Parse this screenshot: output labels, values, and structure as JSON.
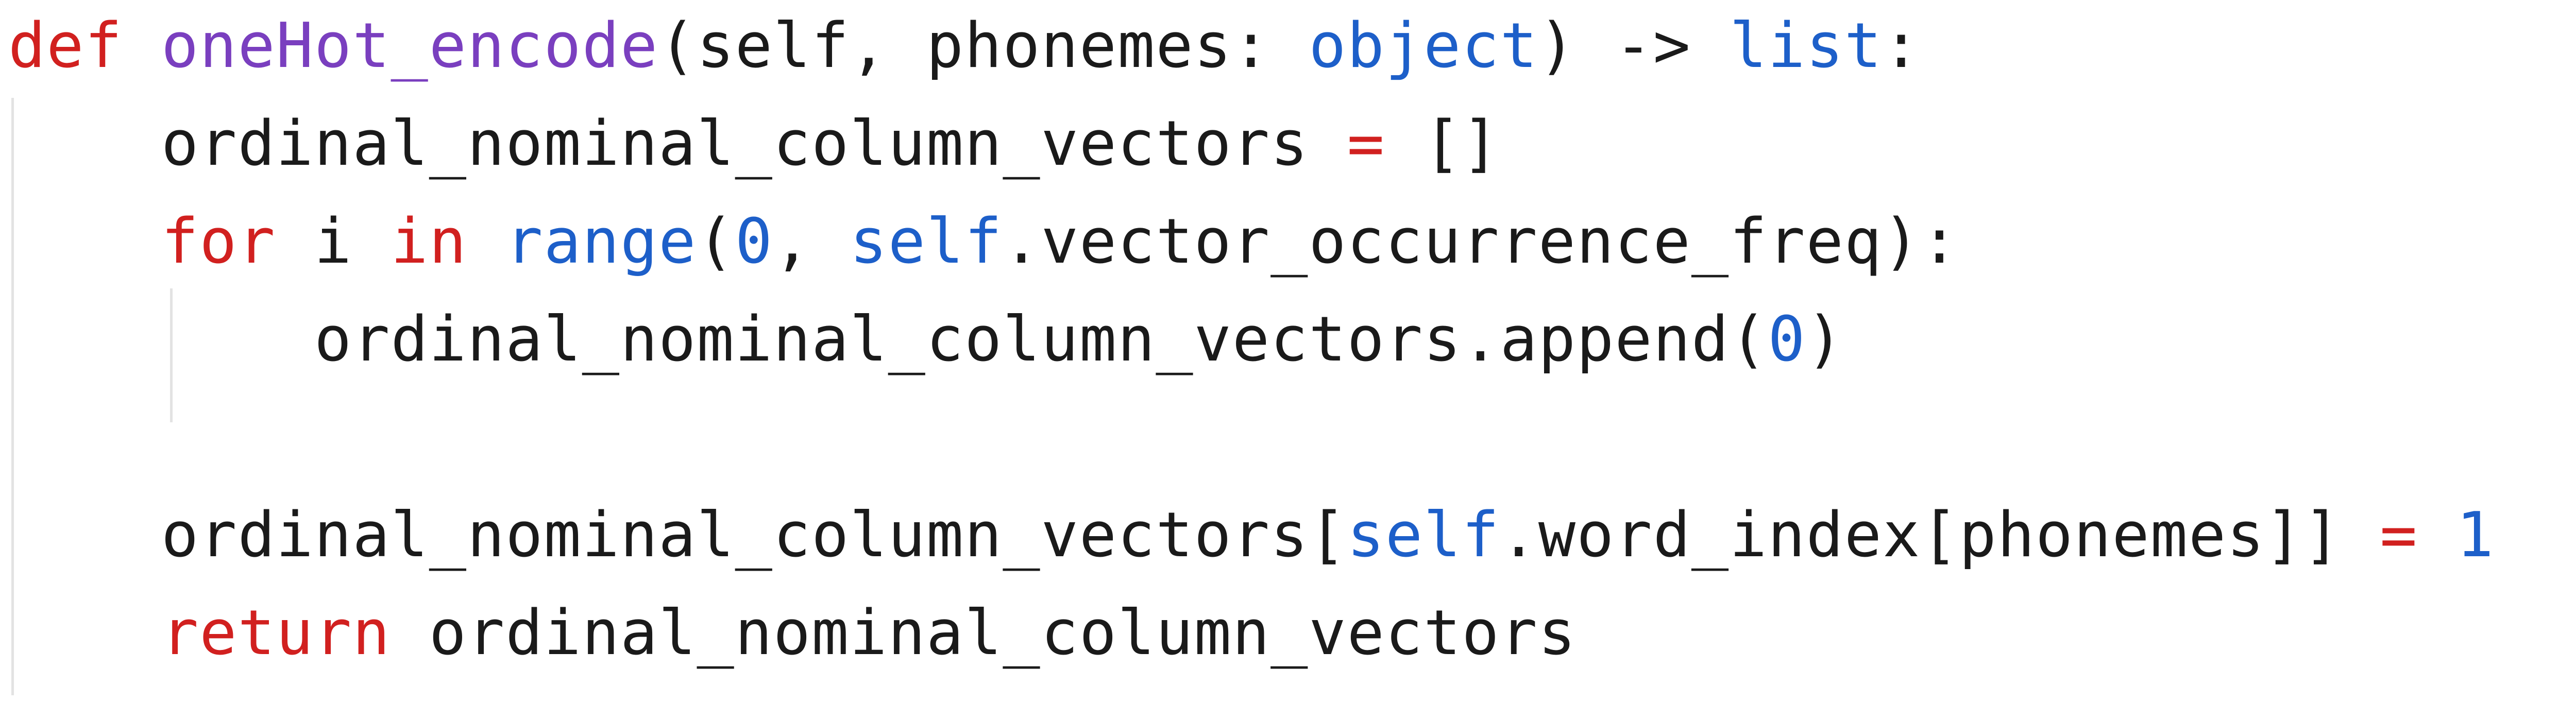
{
  "editor": {
    "colors": {
      "background": "#ffffff",
      "text": "#1a1a1a",
      "keyword": "#d1201f",
      "function_name": "#7a3fbf",
      "builtin": "#1d5fc9",
      "number": "#1d5fc9",
      "operator": "#d1201f",
      "indent_guide": "#e3e3e3"
    },
    "lines": [
      {
        "tokens": [
          {
            "text": "def",
            "kind": "keyword"
          },
          {
            "text": " ",
            "kind": "plain"
          },
          {
            "text": "oneHot_encode",
            "kind": "function_name"
          },
          {
            "text": "(self, phonemes: ",
            "kind": "plain"
          },
          {
            "text": "object",
            "kind": "builtin"
          },
          {
            "text": ") -> ",
            "kind": "plain"
          },
          {
            "text": "list",
            "kind": "builtin"
          },
          {
            "text": ":",
            "kind": "plain"
          }
        ]
      },
      {
        "tokens": [
          {
            "text": "    ordinal_nominal_column_vectors ",
            "kind": "plain"
          },
          {
            "text": "=",
            "kind": "operator"
          },
          {
            "text": " []",
            "kind": "plain"
          }
        ]
      },
      {
        "tokens": [
          {
            "text": "    ",
            "kind": "plain"
          },
          {
            "text": "for",
            "kind": "keyword"
          },
          {
            "text": " i ",
            "kind": "plain"
          },
          {
            "text": "in",
            "kind": "keyword"
          },
          {
            "text": " ",
            "kind": "plain"
          },
          {
            "text": "range",
            "kind": "builtin"
          },
          {
            "text": "(",
            "kind": "plain"
          },
          {
            "text": "0",
            "kind": "number"
          },
          {
            "text": ", ",
            "kind": "plain"
          },
          {
            "text": "self",
            "kind": "builtin"
          },
          {
            "text": ".vector_occurrence_freq):",
            "kind": "plain"
          }
        ]
      },
      {
        "tokens": [
          {
            "text": "        ordinal_nominal_column_vectors.append(",
            "kind": "plain"
          },
          {
            "text": "0",
            "kind": "number"
          },
          {
            "text": ")",
            "kind": "plain"
          }
        ]
      },
      {
        "tokens": []
      },
      {
        "tokens": [
          {
            "text": "    ordinal_nominal_column_vectors[",
            "kind": "plain"
          },
          {
            "text": "self",
            "kind": "builtin"
          },
          {
            "text": ".word_index[phonemes]] ",
            "kind": "plain"
          },
          {
            "text": "=",
            "kind": "operator"
          },
          {
            "text": " ",
            "kind": "plain"
          },
          {
            "text": "1",
            "kind": "number"
          }
        ]
      },
      {
        "tokens": [
          {
            "text": "    ",
            "kind": "plain"
          },
          {
            "text": "return",
            "kind": "keyword"
          },
          {
            "text": " ordinal_nominal_column_vectors",
            "kind": "plain"
          }
        ]
      }
    ]
  }
}
